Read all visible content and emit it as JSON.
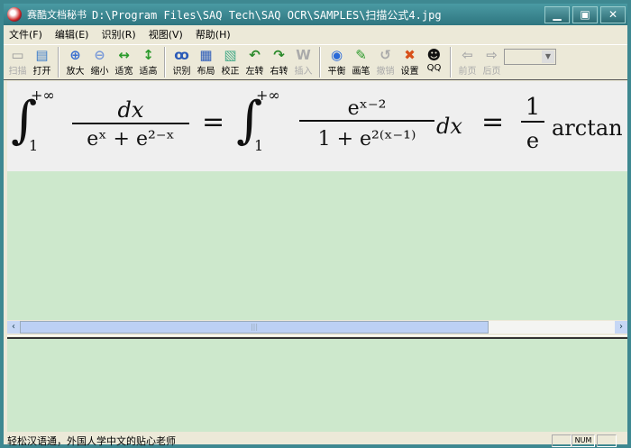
{
  "title": {
    "app": "赛酷文档秘书",
    "path": "D:\\Program Files\\SAQ Tech\\SAQ OCR\\SAMPLES\\扫描公式4.jpg"
  },
  "window_buttons": [
    "minimize",
    "maximize",
    "close"
  ],
  "menu": [
    "文件(F)",
    "编辑(E)",
    "识别(R)",
    "视图(V)",
    "帮助(H)"
  ],
  "toolbar": [
    {
      "label": "扫描",
      "icon": "scanner-icon",
      "enabled": false
    },
    {
      "label": "打开",
      "icon": "open-icon",
      "enabled": true
    },
    {
      "label": "放大",
      "icon": "zoom-in-icon",
      "enabled": true
    },
    {
      "label": "缩小",
      "icon": "zoom-out-icon",
      "enabled": true
    },
    {
      "label": "适宽",
      "icon": "fit-width-icon",
      "enabled": true
    },
    {
      "label": "适高",
      "icon": "fit-height-icon",
      "enabled": true
    },
    {
      "label": "识别",
      "icon": "recognize-icon",
      "enabled": true
    },
    {
      "label": "布局",
      "icon": "layout-icon",
      "enabled": true
    },
    {
      "label": "校正",
      "icon": "correct-icon",
      "enabled": true
    },
    {
      "label": "左转",
      "icon": "rotate-left-icon",
      "enabled": true
    },
    {
      "label": "右转",
      "icon": "rotate-right-icon",
      "enabled": true
    },
    {
      "label": "插入",
      "icon": "insert-word-icon",
      "enabled": false
    },
    {
      "label": "平衡",
      "icon": "balance-icon",
      "enabled": true
    },
    {
      "label": "画笔",
      "icon": "pen-icon",
      "enabled": true
    },
    {
      "label": "撤销",
      "icon": "undo-icon",
      "enabled": false
    },
    {
      "label": "设置",
      "icon": "settings-icon",
      "enabled": true
    },
    {
      "label": "QQ",
      "icon": "qq-icon",
      "enabled": true
    },
    {
      "label": "前页",
      "icon": "prev-page-icon",
      "enabled": false
    },
    {
      "label": "后页",
      "icon": "next-page-icon",
      "enabled": false
    }
  ],
  "formula": {
    "lhs_upper": "+∞",
    "lhs_lower": "1",
    "lhs_num": "dx",
    "lhs_den": "eˣ + e²⁻ˣ",
    "eq": "=",
    "rhs_upper": "+∞",
    "rhs_lower": "1",
    "rhs_num": "eˣ⁻²",
    "rhs_den": "1 + e²⁽ˣ⁻¹⁾",
    "rhs_dx": "dx",
    "eq2": "=",
    "frac_num": "1",
    "frac_den": "e",
    "tail": "arctan"
  },
  "status": {
    "text": "轻松汉语通，外国人学中文的贴心老师",
    "num": "NUM"
  }
}
